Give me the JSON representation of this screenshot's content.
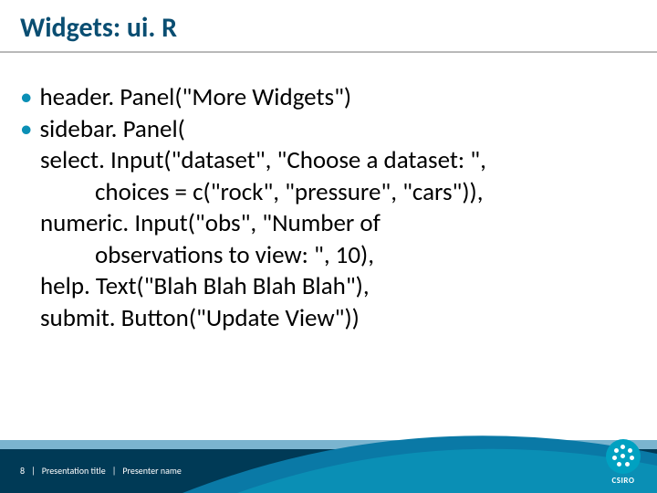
{
  "title": "Widgets: ui. R",
  "lines": {
    "l1": "header. Panel(\"More Widgets\")",
    "l2": "sidebar. Panel(",
    "l3": "select. Input(\"dataset\", \"Choose a dataset: \",",
    "l4": "choices = c(\"rock\", \"pressure\", \"cars\")),",
    "l5": "numeric. Input(\"obs\", \"Number of",
    "l6": "observations to view: \", 10),",
    "l7": "help. Text(\"Blah Blah Blah Blah\"),",
    "l8": "submit. Button(\"Update View\"))"
  },
  "footer": {
    "page": "8",
    "title": "Presentation title",
    "presenter": "Presenter name"
  },
  "logo": "CSIRO"
}
